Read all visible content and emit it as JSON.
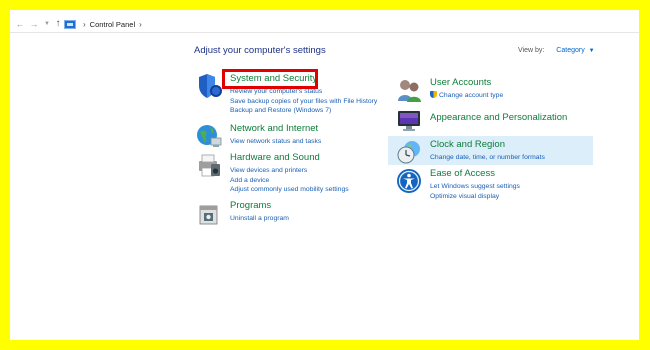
{
  "nav": {
    "back_icon": "back-arrow-icon",
    "forward_icon": "forward-arrow-icon",
    "up_icon": "up-arrow-icon",
    "breadcrumb": "Control Panel"
  },
  "main": {
    "heading": "Adjust your computer's settings",
    "view_by_label": "View by:",
    "view_by_value": "Category"
  },
  "categories_left": [
    {
      "title": "System and Security",
      "links": [
        "Review your computer's status",
        "Save backup copies of your files with File History",
        "Backup and Restore (Windows 7)"
      ]
    },
    {
      "title": "Network and Internet",
      "links": [
        "View network status and tasks"
      ]
    },
    {
      "title": "Hardware and Sound",
      "links": [
        "View devices and printers",
        "Add a device",
        "Adjust commonly used mobility settings"
      ]
    },
    {
      "title": "Programs",
      "links": [
        "Uninstall a program"
      ]
    }
  ],
  "categories_right": [
    {
      "title": "User Accounts",
      "links": [
        "Change account type"
      ]
    },
    {
      "title": "Appearance and Personalization",
      "links": []
    },
    {
      "title": "Clock and Region",
      "links": [
        "Change date, time, or number formats"
      ]
    },
    {
      "title": "Ease of Access",
      "links": [
        "Let Windows suggest settings",
        "Optimize visual display"
      ]
    }
  ],
  "colors": {
    "frame": "#ffff00",
    "heading": "#1e3287",
    "category_title": "#0d7d3a",
    "link": "#1a5fb4",
    "highlight": "#e00000",
    "selected_row": "#dbeef9"
  }
}
